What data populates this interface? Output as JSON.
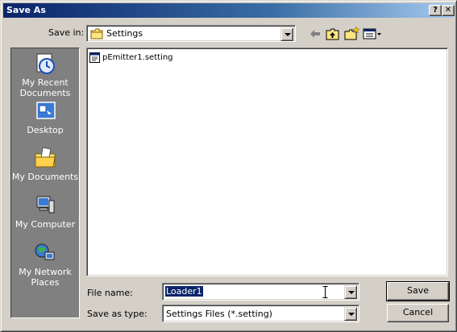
{
  "window": {
    "title": "Save As",
    "help_label": "?",
    "close_label": "✕"
  },
  "toolbar": {
    "save_in_label": "Save in:",
    "save_in_value": "Settings",
    "icons": [
      "back-arrow-icon",
      "up-folder-icon",
      "new-folder-icon",
      "views-menu-icon"
    ]
  },
  "places": {
    "recent": "My Recent Documents",
    "desktop": "Desktop",
    "documents": "My Documents",
    "computer": "My Computer",
    "network": "My Network Places"
  },
  "files": [
    {
      "name": "pEmitter1.setting",
      "icon": "settings-file-icon"
    }
  ],
  "form": {
    "file_name_label": "File name:",
    "file_name_value": "Loader1",
    "save_type_label": "Save as type:",
    "save_type_value": "Settings Files (*.setting)"
  },
  "buttons": {
    "save": "Save",
    "cancel": "Cancel"
  },
  "colors": {
    "face": "#d4d0c8",
    "titlebar_start": "#0a246a",
    "titlebar_end": "#a6caf0",
    "places_bg": "#808080",
    "selection": "#0a246a"
  }
}
